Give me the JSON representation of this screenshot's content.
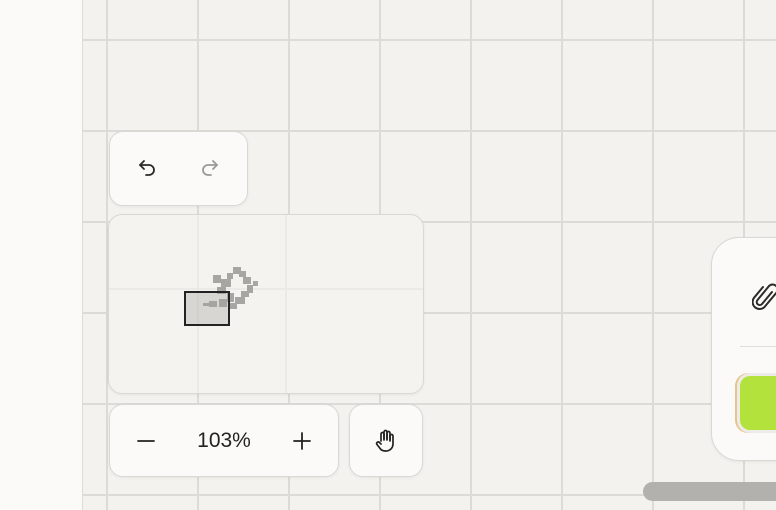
{
  "history": {
    "undo_icon": "undo-icon",
    "redo_icon": "redo-icon"
  },
  "zoom": {
    "level": "103%",
    "zoom_out_icon": "minus-icon",
    "zoom_in_icon": "plus-icon"
  },
  "tools": {
    "hand_icon": "hand-icon"
  },
  "chat": {
    "attach_icon": "paperclip-icon"
  },
  "colors": {
    "canvas": "#f3f2ef",
    "grid": "#dcdbd7",
    "panel": "#fbfaf8",
    "accent_green": "#b4e23c",
    "scrollbar": "#b2b1ae"
  }
}
